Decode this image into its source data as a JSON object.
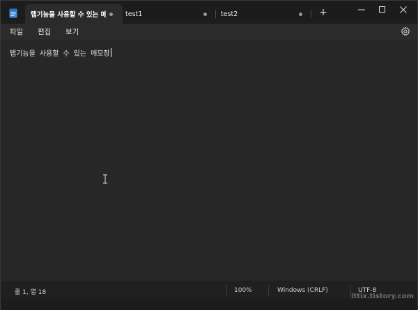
{
  "tabs": [
    {
      "label": "탭기능을 사용할 수 있는 메",
      "active": true,
      "modified": true
    },
    {
      "label": "test1",
      "active": false,
      "modified": true
    },
    {
      "label": "test2",
      "active": false,
      "modified": true
    }
  ],
  "new_tab_label": "+",
  "menu": {
    "file": "파일",
    "edit": "편집",
    "view": "보기"
  },
  "editor": {
    "content": "탭기능을 사용할 수 있는 메모장"
  },
  "status": {
    "position": "줄 1, 열 18",
    "zoom": "100%",
    "line_ending": "Windows (CRLF)",
    "encoding": "UTF-8"
  },
  "watermark": "ittix.tistory.com",
  "colors": {
    "titlebar": "#1c1c1c",
    "active_tab": "#2b2b2b",
    "editor_bg": "#272727",
    "text": "#e4e4e4"
  },
  "icons": {
    "app": "notepad-icon",
    "settings": "gear-icon",
    "minimize": "minimize-icon",
    "maximize": "maximize-icon",
    "close": "close-icon"
  }
}
